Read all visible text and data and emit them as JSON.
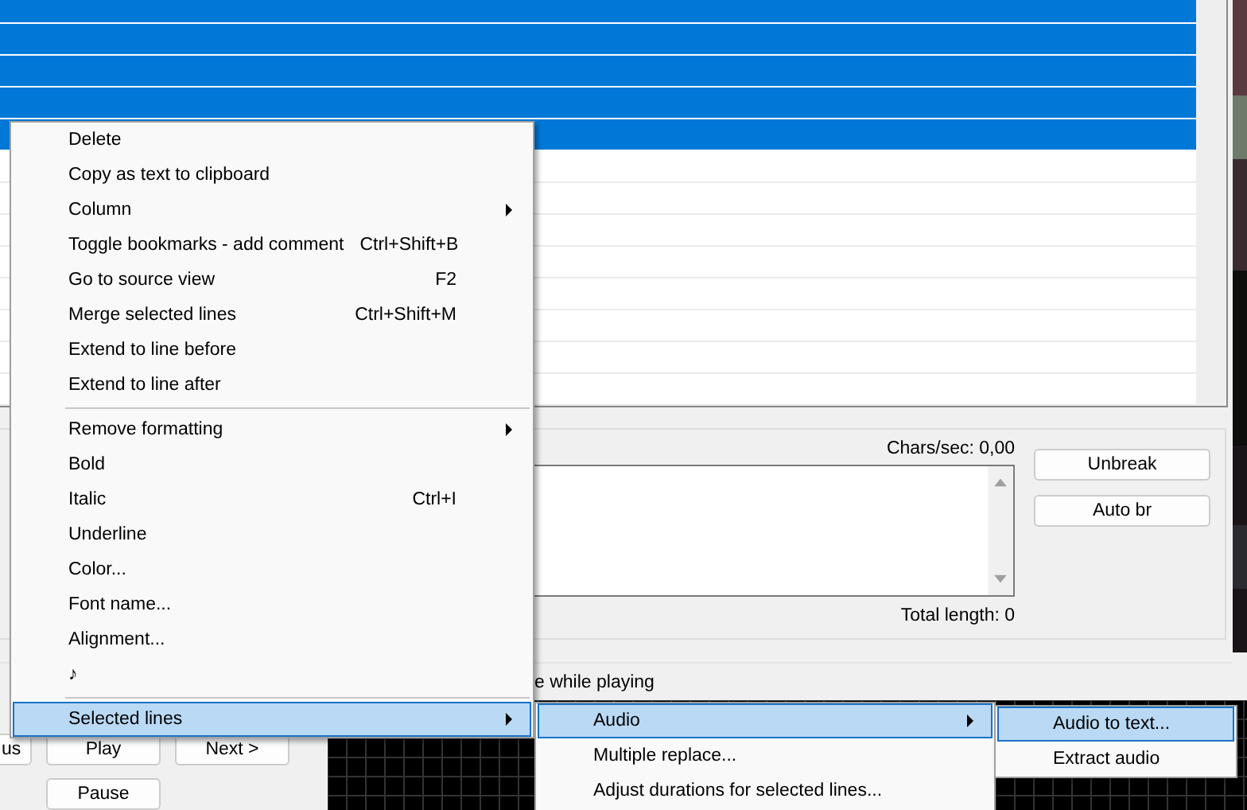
{
  "subtitle_list": {
    "rows": [
      {
        "selected": true
      },
      {
        "selected": true
      },
      {
        "selected": true
      },
      {
        "selected": true
      },
      {
        "selected": true
      },
      {
        "selected": false
      },
      {
        "selected": false
      },
      {
        "selected": false
      },
      {
        "selected": false
      },
      {
        "selected": false
      },
      {
        "selected": false
      },
      {
        "selected": false
      },
      {
        "selected": false
      }
    ]
  },
  "edit_panel": {
    "chars_per_sec": "Chars/sec: 0,00",
    "total_length": "Total length: 0",
    "buttons": [
      "Unbreak",
      "Auto br"
    ]
  },
  "options_bar": {
    "checkbox_label": "e while playing"
  },
  "playback_buttons": [
    "us",
    "Play",
    "Next >",
    "Pause"
  ],
  "context_menu": [
    {
      "kind": "item",
      "label": "Delete",
      "submenu": false,
      "selected": false
    },
    {
      "kind": "item",
      "label": "Copy as text to clipboard",
      "submenu": false,
      "selected": false
    },
    {
      "kind": "item",
      "label": "Column",
      "submenu": true,
      "selected": false
    },
    {
      "kind": "item",
      "label": "Toggle bookmarks - add comment",
      "shortcut": "Ctrl+Shift+B",
      "submenu": false,
      "selected": false
    },
    {
      "kind": "item",
      "label": "Go to source view",
      "shortcut": "F2",
      "submenu": false,
      "selected": false
    },
    {
      "kind": "item",
      "label": "Merge selected lines",
      "shortcut": "Ctrl+Shift+M",
      "submenu": false,
      "selected": false
    },
    {
      "kind": "item",
      "label": "Extend to line before",
      "submenu": false,
      "selected": false
    },
    {
      "kind": "item",
      "label": "Extend to line after",
      "submenu": false,
      "selected": false
    },
    {
      "kind": "separator"
    },
    {
      "kind": "item",
      "label": "Remove formatting",
      "submenu": true,
      "selected": false
    },
    {
      "kind": "item",
      "label": "Bold",
      "submenu": false,
      "selected": false
    },
    {
      "kind": "item",
      "label": "Italic",
      "shortcut": "Ctrl+I",
      "submenu": false,
      "selected": false
    },
    {
      "kind": "item",
      "label": "Underline",
      "submenu": false,
      "selected": false
    },
    {
      "kind": "item",
      "label": "Color...",
      "submenu": false,
      "selected": false
    },
    {
      "kind": "item",
      "label": "Font name...",
      "submenu": false,
      "selected": false
    },
    {
      "kind": "item",
      "label": "Alignment...",
      "submenu": false,
      "selected": false
    },
    {
      "kind": "item",
      "label": "♪",
      "submenu": false,
      "selected": false
    },
    {
      "kind": "separator"
    },
    {
      "kind": "item",
      "label": "Selected lines",
      "submenu": true,
      "selected": true
    }
  ],
  "submenu": [
    {
      "kind": "item",
      "label": "Audio",
      "submenu": true,
      "selected": true
    },
    {
      "kind": "item",
      "label": "Multiple replace...",
      "submenu": false,
      "selected": false
    },
    {
      "kind": "item",
      "label": "Adjust durations for selected lines...",
      "submenu": false,
      "selected": false
    }
  ],
  "submenu_2": [
    {
      "kind": "item",
      "label": "Audio to text...",
      "submenu": false,
      "selected": true
    },
    {
      "kind": "item",
      "label": "Extract audio",
      "submenu": false,
      "selected": false
    }
  ]
}
